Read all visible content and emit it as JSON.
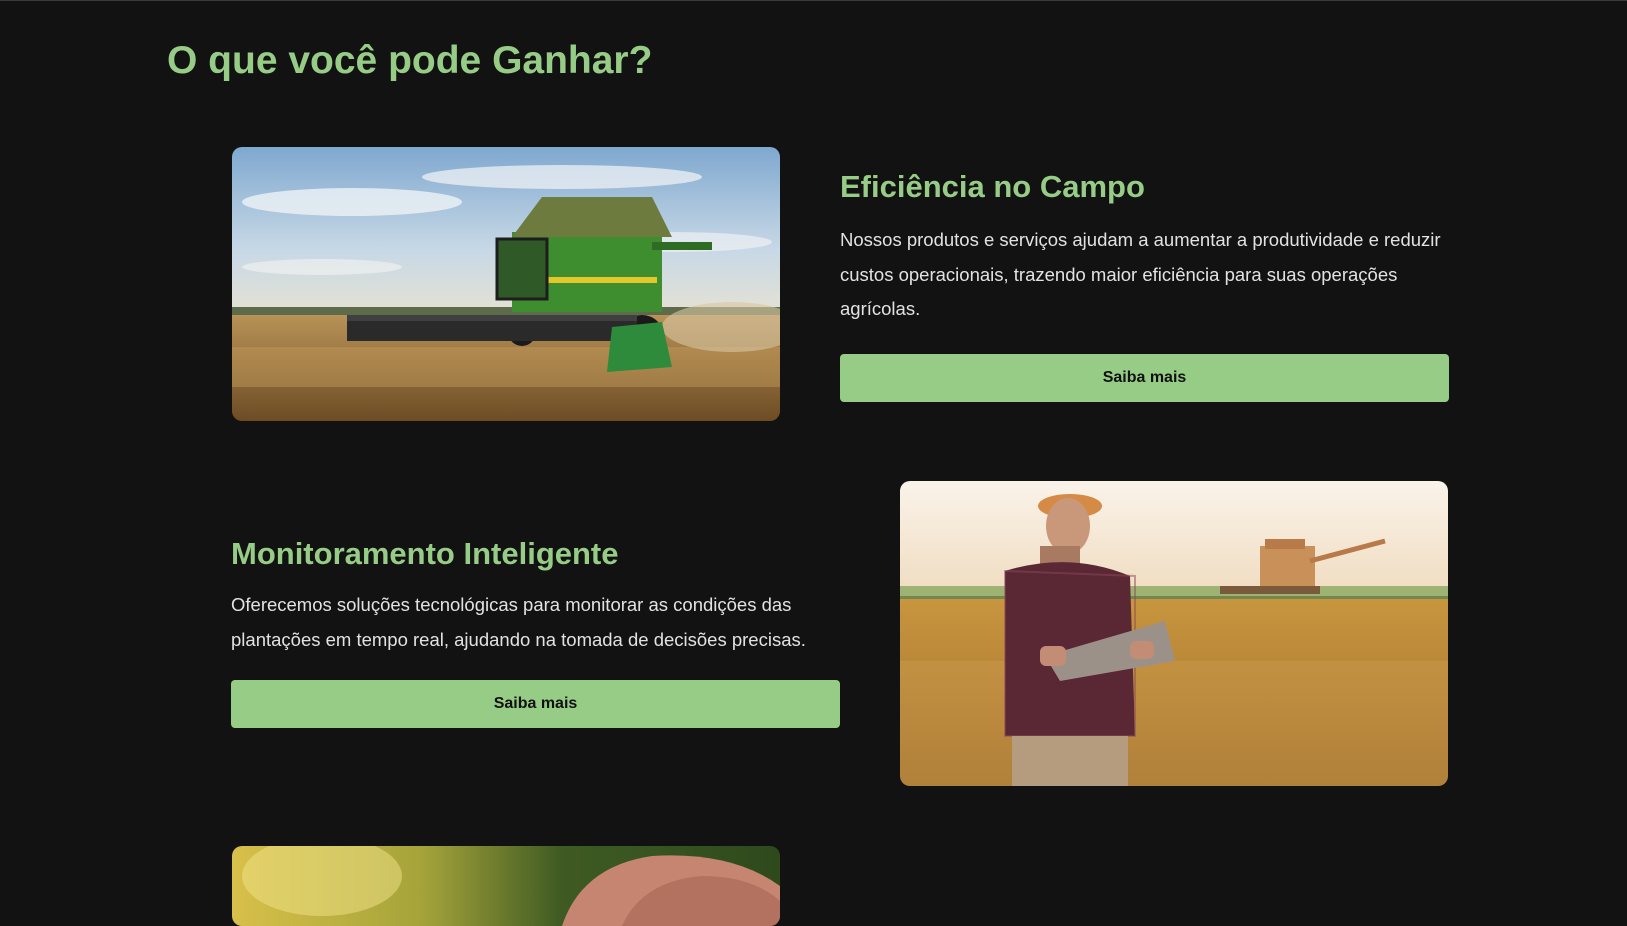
{
  "section": {
    "title": "O que você pode Ganhar?"
  },
  "cards": [
    {
      "title": "Eficiência no Campo",
      "description": "Nossos produtos e serviços ajudam a aumentar a produtividade e reduzir custos operacionais, trazendo maior eficiência para suas operações agrícolas.",
      "button_label": "Saiba mais",
      "image": "combine-harvester-photo"
    },
    {
      "title": "Monitoramento Inteligente",
      "description": "Oferecemos soluções tecnológicas para monitorar as condições das plantações em tempo real, ajudando na tomada de decisões precisas.",
      "button_label": "Saiba mais",
      "image": "farmer-with-laptop-photo"
    },
    {
      "image": "hand-with-grain-photo"
    }
  ],
  "colors": {
    "background": "#121212",
    "accent": "#97cc86",
    "text": "#e2e2e2",
    "button_text": "#111111"
  }
}
